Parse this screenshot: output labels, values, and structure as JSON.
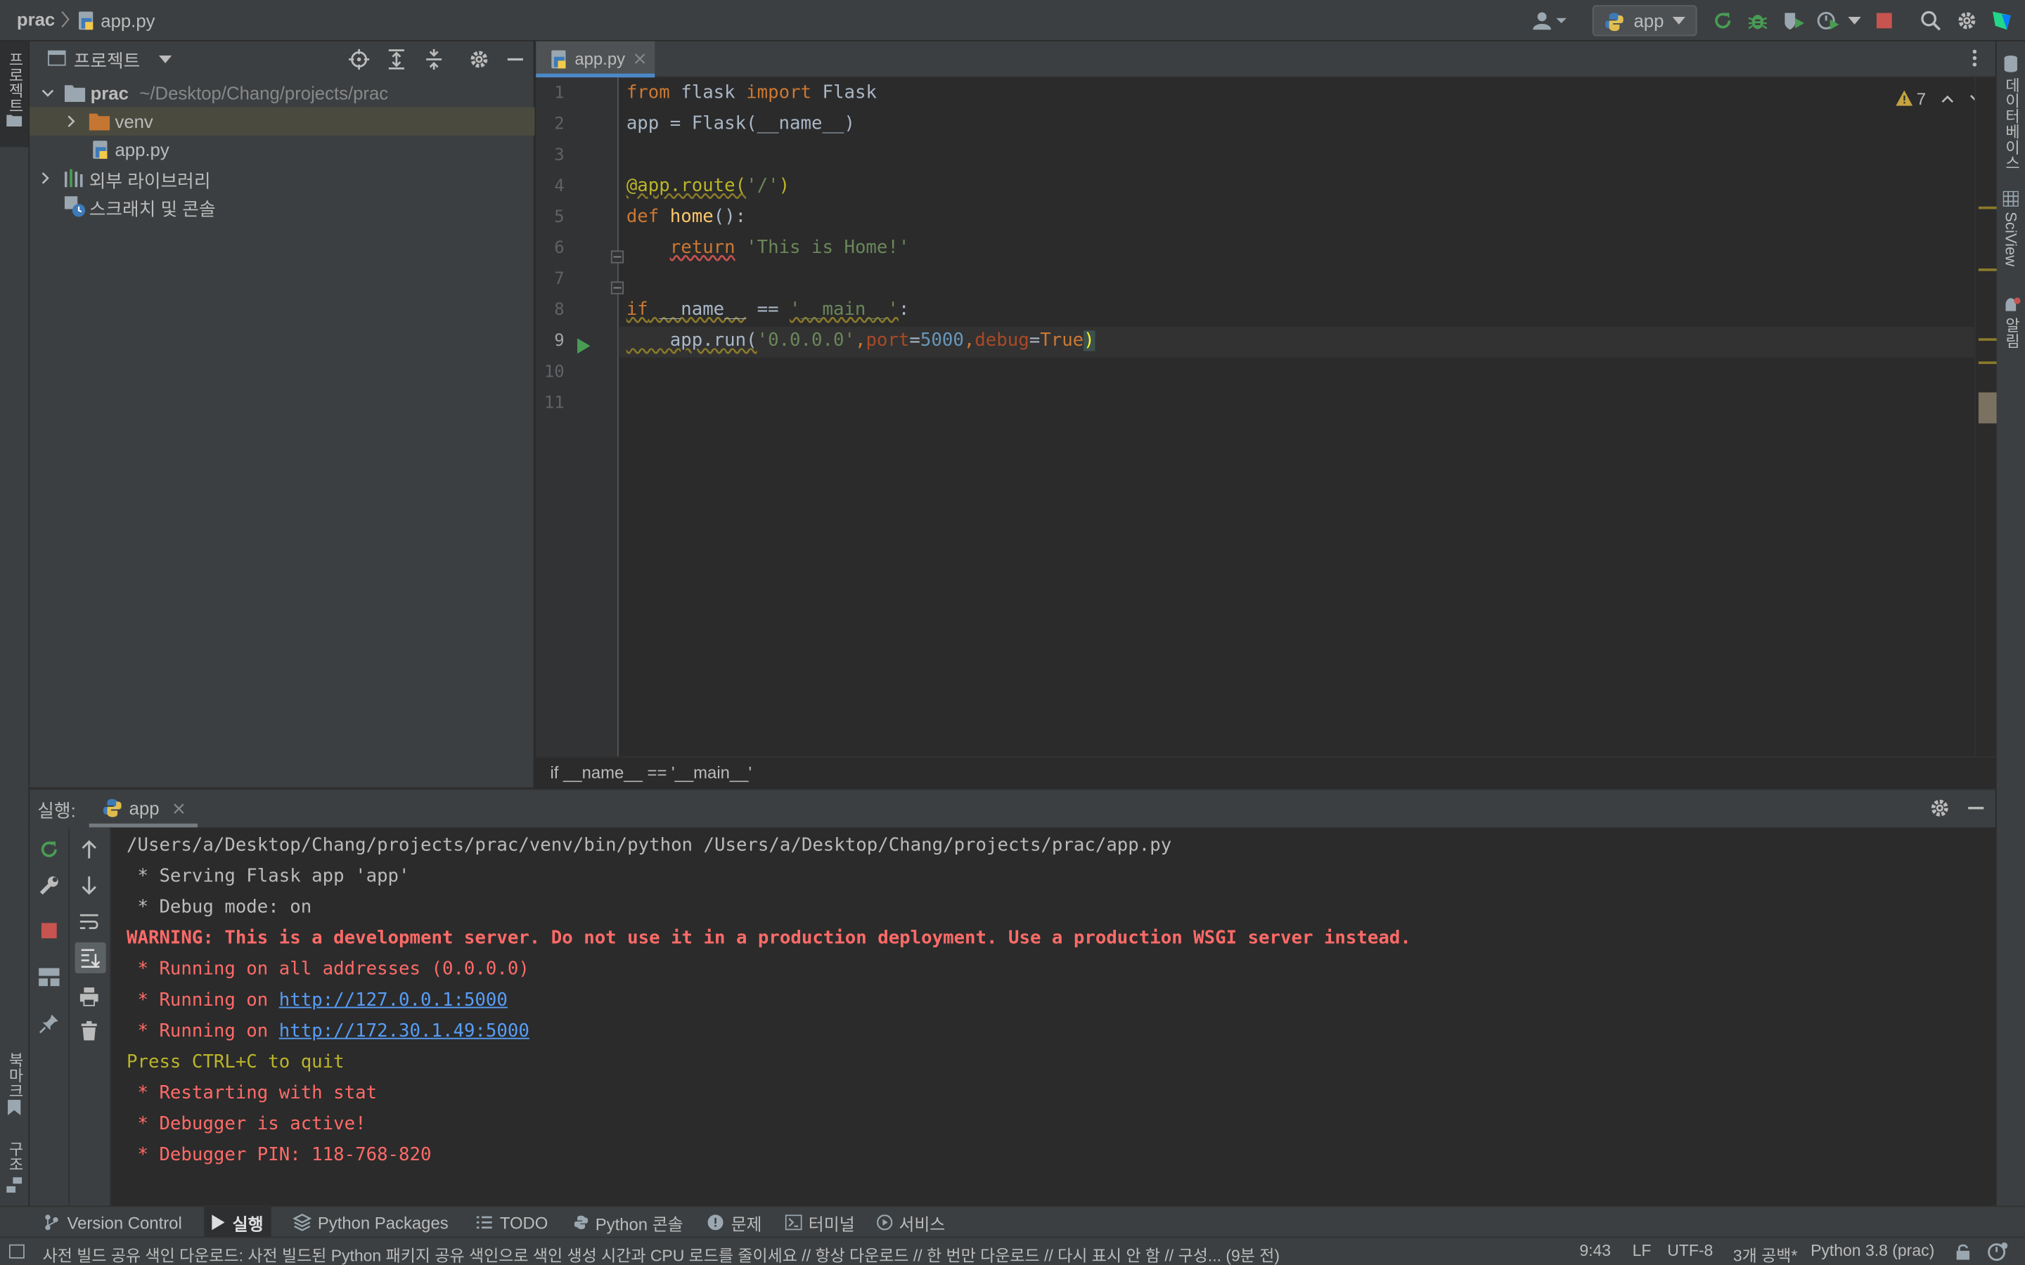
{
  "navbar": {
    "project": "prac",
    "file": "app.py",
    "run_config": "app"
  },
  "left_stripe": {
    "project_tab": "프로젝트",
    "bookmarks_tab": "북마크",
    "structure_tab": "구조"
  },
  "right_stripe": {
    "database_tab": "데이터베이스",
    "sciview_tab": "SciView",
    "notifications_tab": "알림"
  },
  "project_panel": {
    "title": "프로젝트",
    "tree": [
      {
        "name": "prac",
        "path": "~/Desktop/Chang/projects/prac"
      },
      {
        "name": "venv"
      },
      {
        "name": "app.py"
      },
      {
        "name": "외부 라이브러리"
      },
      {
        "name": "스크래치 및 콘솔"
      }
    ]
  },
  "editor": {
    "tab": "app.py",
    "warnings_count": "7",
    "line_numbers": [
      "1",
      "2",
      "3",
      "4",
      "5",
      "6",
      "7",
      "8",
      "9",
      "10",
      "11"
    ],
    "lines": [
      {
        "t1": "from",
        "t2": " flask ",
        "t3": "import",
        "t4": " Flask"
      },
      {
        "t1": "app = Flask(__name__)"
      },
      {
        "t1": ""
      },
      {
        "t1": "@app.route(",
        "t2": "'/'",
        "t3": ")"
      },
      {
        "t1": "def",
        "t2": " home",
        "t3": "():"
      },
      {
        "t1": "    ",
        "t2": "return",
        "t3": " 'This is Home!'"
      },
      {
        "t1": ""
      },
      {
        "t1": "if",
        "t2": " __name__",
        "t3": " == ",
        "t4": "'__main__'",
        "t5": ":"
      },
      {
        "t1": "    app.run(",
        "t2": "'0.0.0.0'",
        "t3": ",",
        "t4": "port",
        "t5": "=",
        "t6": "5000",
        "t7": ",",
        "t8": "debug",
        "t9": "=",
        "t10": "True",
        "t11": ")"
      },
      {
        "t1": ""
      },
      {
        "t1": ""
      }
    ],
    "breadcrumb": "if __name__ == '__main__'"
  },
  "run_panel": {
    "label": "실행:",
    "tab": "app",
    "output": {
      "l1": "/Users/a/Desktop/Chang/projects/prac/venv/bin/python /Users/a/Desktop/Chang/projects/prac/app.py",
      "l2": " * Serving Flask app 'app'",
      "l3": " * Debug mode: on",
      "l4": "WARNING: This is a development server. Do not use it in a production deployment. Use a production WSGI server instead.",
      "l5": " * Running on all addresses (0.0.0.0)",
      "l6_prefix": " * Running on ",
      "l6_link": "http://127.0.0.1:5000",
      "l7_prefix": " * Running on ",
      "l7_link": "http://172.30.1.49:5000",
      "l8": "Press CTRL+C to quit",
      "l9": " * Restarting with stat",
      "l10": " * Debugger is active!",
      "l11": " * Debugger PIN: 118-768-820"
    }
  },
  "tool_windows": {
    "vcs": "Version Control",
    "run": "실행",
    "packages": "Python Packages",
    "todo": "TODO",
    "console": "Python 콘솔",
    "problems": "문제",
    "terminal": "터미널",
    "services": "서비스"
  },
  "status_bar": {
    "message": "사전 빌드 공유 색인 다운로드: 사전 빌드된 Python 패키지 공유 색인으로 색인 생성 시간과 CPU 로드를 줄이세요 // 항상 다운로드 // 한 번만 다운로드 // 다시 표시 안 함 // 구성... (9분 전)",
    "position": "9:43",
    "line_sep": "LF",
    "encoding": "UTF-8",
    "indent": "3개 공백*",
    "interpreter": "Python 3.8 (prac)"
  },
  "colors": {
    "accent_green": "#499c54",
    "stop_red": "#c75450",
    "folder_orange": "#c57633",
    "link_blue": "#589df6",
    "error_red": "#ff6b68"
  }
}
